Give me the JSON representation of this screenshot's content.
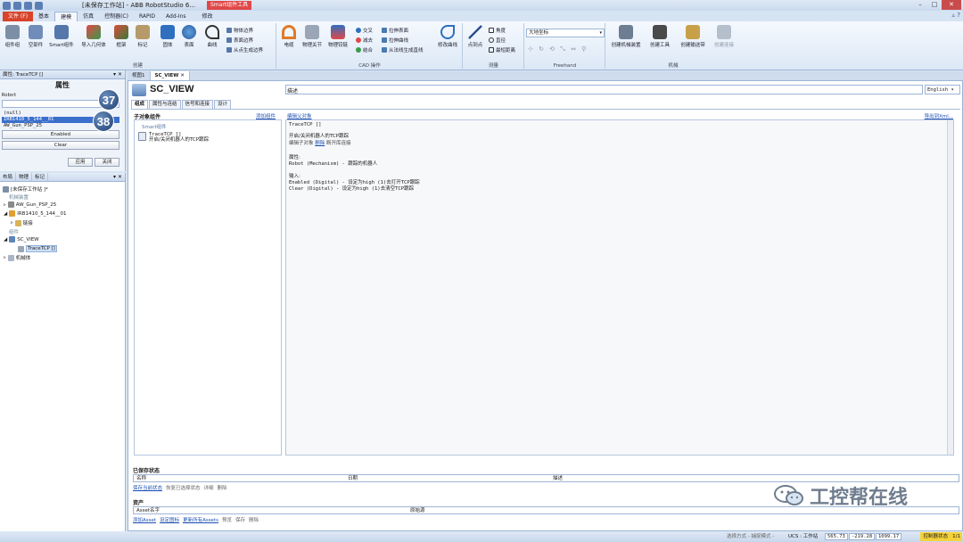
{
  "window": {
    "title": "[未保存工作站] - ABB RobotStudio 6...",
    "context_tab": "Smart组件工具",
    "controls": [
      "–",
      "□",
      "✕"
    ]
  },
  "ribbon_tabs": [
    "文件 (F)",
    "基本",
    "建模",
    "仿真",
    "控制器(C)",
    "RAPID",
    "Add-Ins",
    "修改"
  ],
  "ribbon": {
    "create_group": {
      "label": "创建",
      "buttons": [
        "组件组",
        "空部件",
        "Smart组件",
        "导入几何体",
        "框架",
        "标记",
        "固体",
        "表面",
        "曲线"
      ],
      "small": [
        "物体边界",
        "表面边界",
        "从点生成边界"
      ]
    },
    "cad_group": {
      "label": "CAD 操作",
      "big": [
        "电缆",
        "物理关节",
        "物理铰链"
      ],
      "small": [
        "交叉",
        "拉伸表面",
        "减去",
        "拉伸曲线",
        "结合",
        "从法线生成直线"
      ],
      "modify_curve": "修改曲线"
    },
    "measure_group": {
      "label": "测量",
      "big": "点到点",
      "small": [
        "角度",
        "直径",
        "最短距离"
      ]
    },
    "freehand_group": {
      "label": "Freehand",
      "coord_value": "大地坐标"
    },
    "mechanism_group": {
      "label": "机械",
      "buttons": [
        "创建机械装置",
        "创建工具",
        "创建输送带",
        "创建连接"
      ]
    }
  },
  "props_panel": {
    "header": "属性: TraceTCP []",
    "title": "属性",
    "robot_label": "Robot",
    "robot_value": "",
    "list_items": [
      "(null)",
      "IRB1410_5_144__01",
      "AW_Gun_PSP_25"
    ],
    "enabled_label": "Enabled",
    "clear_label": "Clear",
    "apply_label": "应用",
    "close_label": "关闭",
    "badge1": "37",
    "badge2": "38"
  },
  "tree_panel": {
    "tabs": [
      "布局",
      "物理",
      "标记"
    ],
    "items": [
      {
        "label": "[未保存工作站 ]*",
        "kind": "station"
      },
      {
        "label": "机械装置",
        "kind": "cat"
      },
      {
        "label": "AW_Gun_PSP_25",
        "kind": "mech"
      },
      {
        "label": "IRB1410_5_144__01",
        "kind": "mech"
      },
      {
        "label": "链接",
        "kind": "folder"
      },
      {
        "label": "组件",
        "kind": "cat"
      },
      {
        "label": "SC_VIEW",
        "kind": "smart"
      },
      {
        "label": "TraceTCP []",
        "kind": "comp"
      },
      {
        "label": "机械体",
        "kind": "body"
      }
    ]
  },
  "doc": {
    "tabs": [
      "视图1",
      "SC_VIEW ✕"
    ],
    "title": "SC_VIEW",
    "desc_label": "描述",
    "language": "English",
    "inner_tabs": [
      "组成",
      "属性与连结",
      "信号和连接",
      "设计"
    ],
    "sub_header": "子对象组件",
    "add_component": "添加组件",
    "edit_parent": "编辑父对象",
    "export_xml": "导出到Xml...",
    "smart_header": "Smart组件",
    "comp_name": "TraceTCP []",
    "comp_desc": "开启/关闭机器人的TCP跟踪",
    "detail": {
      "name": "TraceTCP []",
      "desc": "开启/关闭机器人的TCP跟踪",
      "edit_child": "编辑子对象",
      "delete": "删除",
      "disconnect": "断开库连接",
      "props_title": "属性:",
      "prop_robot": "Robot (Mechanism) - 跟踪的机器人",
      "inputs_title": "输入:",
      "input_enabled": "Enabled (Digital) - 设定为high (1)去打开TCP跟踪",
      "input_clear": "Clear (Digital) - 设定为high (1)去清空TCP跟踪"
    },
    "saved_state": {
      "title": "已保存状态",
      "col_name": "名称",
      "col_date": "日期",
      "col_desc": "描述",
      "links": [
        "保存当前状态",
        "恢复已选择状态",
        "详细",
        "删除"
      ]
    },
    "assets": {
      "title": "资产",
      "col_name": "Asset名字",
      "col_source": "原始源",
      "links": [
        "添加Asset",
        "设定图标",
        "更新所有Assets",
        "预览",
        "保存",
        "删除"
      ]
    }
  },
  "watermark": "工控帮在线",
  "statusbar": {
    "select_mode": "选择方式 - 捕捉模式 -",
    "ucs": "UCS : 工作站",
    "x": "565.73",
    "y": "-219.28",
    "z": "1099.17",
    "controller_status": "控制器状态",
    "count": "1/1"
  },
  "colors": {
    "accent": "#3a6fcc",
    "file_tab": "#d9432b",
    "ctx_tab": "#e04848",
    "link": "#1d4fb3",
    "status_yellow": "#f5d23a"
  }
}
